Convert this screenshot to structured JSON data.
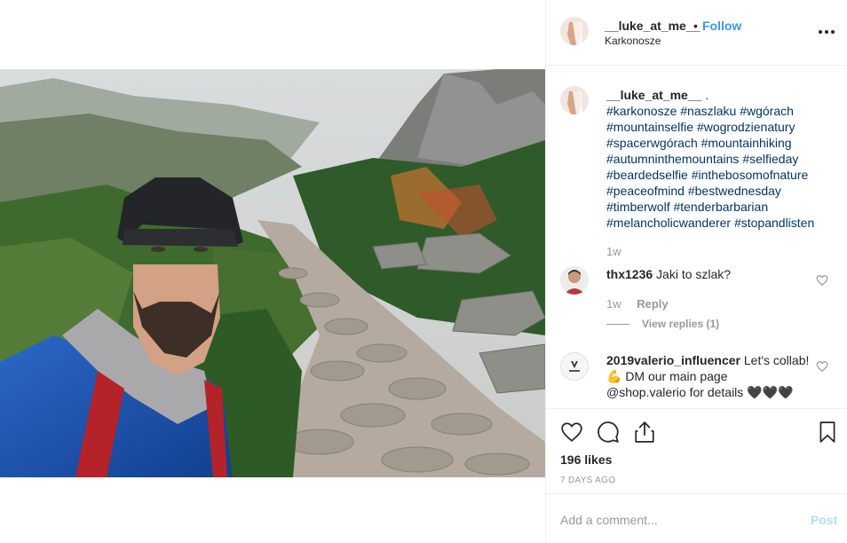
{
  "post": {
    "username": "__luke_at_me__",
    "separator": "•",
    "follow_label": "Follow",
    "location": "Karkonosze",
    "more_icon": "more-horizontal-icon"
  },
  "caption": {
    "username": "__luke_at_me__",
    "suffix": " .",
    "hashtags": "#karkonosze #naszlaku #wgórach #mountainselfie #wogrodzienatury #spacerwgórach #mountainhiking #autumninthemountains #selfieday #beardedselfie #inthebosomofnature #peaceofmind #bestwednesday #timberwolf #tenderbarbarian #melancholicwanderer #stopandlisten",
    "age": "1w"
  },
  "comments": [
    {
      "username": "thx1236",
      "text": "Jaki to szlak?",
      "age": "1w",
      "reply_label": "Reply",
      "view_replies": "View replies (1)"
    },
    {
      "username": "2019valerio_influencer",
      "text": "Let's collab! 💪 DM our main page @shop.valerio for details 🖤🖤🖤"
    }
  ],
  "actions": {
    "likes": "196 likes",
    "date": "7 DAYS AGO"
  },
  "add_comment": {
    "placeholder": "Add a comment...",
    "post_label": "Post"
  },
  "colors": {
    "link": "#3897f0",
    "hashtag": "#003569",
    "muted": "#999999",
    "post_disabled": "#b2dffc"
  }
}
